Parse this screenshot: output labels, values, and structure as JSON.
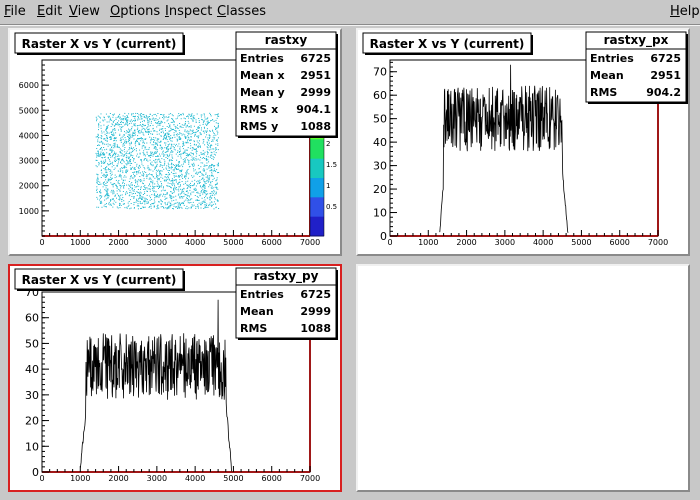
{
  "menu": {
    "items": [
      {
        "label": "File",
        "u": "F",
        "rest": "ile"
      },
      {
        "label": "Edit",
        "u": "E",
        "rest": "dit"
      },
      {
        "label": "View",
        "u": "V",
        "rest": "iew"
      },
      {
        "label": "Options",
        "u": "O",
        "rest": "ptions"
      },
      {
        "label": "Inspect",
        "u": "I",
        "rest": "nspect"
      },
      {
        "label": "Classes",
        "u": "C",
        "rest": "lasses"
      }
    ],
    "help": {
      "label": "Help",
      "u": "H",
      "rest": "elp"
    }
  },
  "colors": {
    "scatter": "#1fb8d0",
    "frame": "#000000",
    "axis_red": "#a01818",
    "active_border": "#d82020",
    "palette": [
      "#2020c8",
      "#3050e8",
      "#10a0e8",
      "#18c8c0",
      "#20e060",
      "#60ff30"
    ]
  },
  "chart_data": [
    {
      "type": "scatter",
      "title": "Raster X vs Y (current)",
      "x_range": [
        0,
        7000
      ],
      "y_range": [
        0,
        7000
      ],
      "x_ticks": [
        0,
        1000,
        2000,
        3000,
        4000,
        5000,
        6000,
        7000
      ],
      "y_ticks": [
        1000,
        2000,
        3000,
        4000,
        5000,
        6000
      ],
      "scatter_region": {
        "x": [
          1400,
          4600
        ],
        "y": [
          1100,
          4900
        ]
      },
      "stats": {
        "name": "rastxy",
        "rows": [
          {
            "label": "Entries",
            "value": "6725"
          },
          {
            "label": "Mean x",
            "value": "2951"
          },
          {
            "label": "Mean y",
            "value": "2999"
          },
          {
            "label": "RMS x",
            "value": "904.1"
          },
          {
            "label": "RMS y",
            "value": "1088"
          }
        ]
      },
      "palette_ticks": [
        "2",
        "1.5",
        "1",
        "0.5"
      ],
      "palette_partial": [
        "4",
        "2"
      ]
    },
    {
      "type": "line",
      "title": "Raster X vs Y (current)",
      "x_range": [
        0,
        7000
      ],
      "y_range": [
        0,
        75
      ],
      "x_ticks": [
        0,
        1000,
        2000,
        3000,
        4000,
        5000,
        6000,
        7000
      ],
      "y_ticks": [
        0,
        10,
        20,
        30,
        40,
        50,
        60,
        70
      ],
      "profile": {
        "start_x": 1300,
        "ramp_x": 1400,
        "end_x": 4500,
        "tail_end_x": 4650,
        "center": 50,
        "amp": 14,
        "maxv": 73,
        "peak_x": 3150
      },
      "stats": {
        "name": "rastxy_px",
        "rows": [
          {
            "label": "Entries",
            "value": "6725"
          },
          {
            "label": "Mean",
            "value": "2951"
          },
          {
            "label": "RMS",
            "value": "904.2"
          }
        ]
      }
    },
    {
      "type": "line",
      "title": "Raster X vs Y (current)",
      "x_range": [
        0,
        7000
      ],
      "y_range": [
        0,
        70
      ],
      "x_ticks": [
        0,
        1000,
        2000,
        3000,
        4000,
        5000,
        6000,
        7000
      ],
      "y_ticks": [
        0,
        10,
        20,
        30,
        40,
        50,
        60,
        70
      ],
      "profile": {
        "start_x": 1000,
        "ramp_x": 1150,
        "end_x": 4800,
        "tail_end_x": 4950,
        "center": 41,
        "amp": 13,
        "maxv": 67,
        "peak_x": 4600
      },
      "stats": {
        "name": "rastxy_py",
        "rows": [
          {
            "label": "Entries",
            "value": "6725"
          },
          {
            "label": "Mean",
            "value": "2999"
          },
          {
            "label": "RMS",
            "value": "1088"
          }
        ]
      }
    }
  ]
}
